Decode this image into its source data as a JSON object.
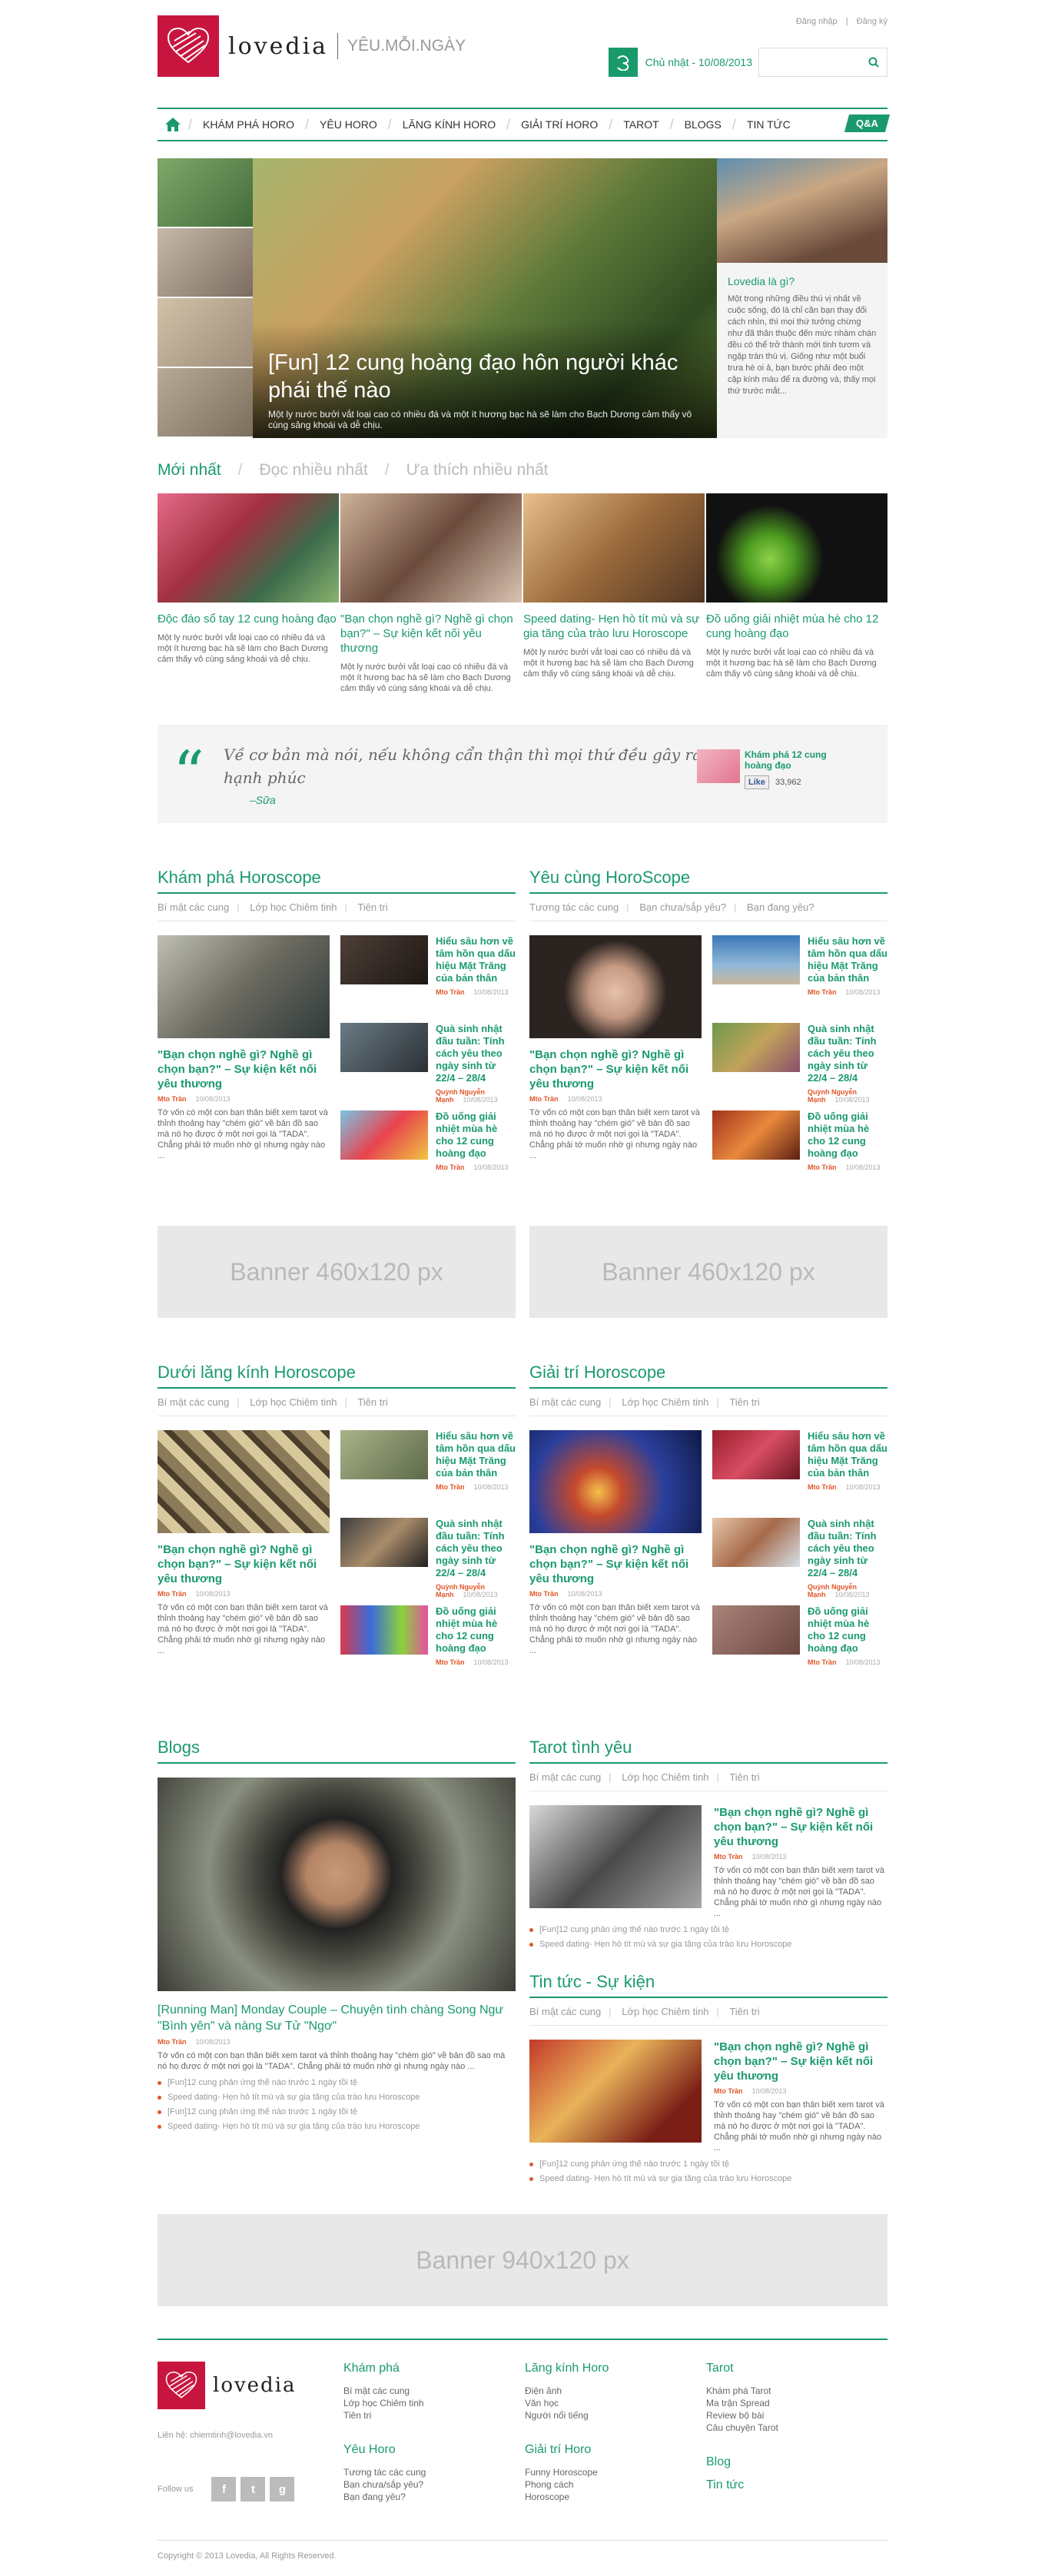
{
  "header": {
    "logo_text": "lovedia",
    "tagline": "YÊU.MỖI.NGÀY",
    "login": "Đăng nhập",
    "sep": "|",
    "register": "Đăng ký",
    "date": "Chủ nhật - 10/08/2013",
    "search_placeholder": ""
  },
  "nav": {
    "items": [
      "KHÁM PHÁ HORO",
      "YÊU HORO",
      "LĂNG KÍNH HORO",
      "GIẢI TRÍ HORO",
      "TAROT",
      "BLOGS",
      "TIN TỨC"
    ],
    "qa": "Q&A"
  },
  "hero": {
    "title": "[Fun] 12 cung hoàng đạo hôn người khác phái thế nào",
    "excerpt": "Một ly nước bưởi vắt loại cao có nhiều đá và một ít hương bạc hà sẽ làm cho Bạch Dương cảm thấy vô cùng sảng khoái và dễ chịu.",
    "side_title": "Lovedia là gì?",
    "side_text": "Một trong những điều thú vị nhất về cuộc sống, đó là chỉ cần bạn thay đổi cách nhìn, thì mọi thứ tưởng chừng như đã thân thuộc đến mức nhàm chán đều có thể trở thành mới tinh tươm và ngập tràn thú vị. Giống như một buổi trưa hè oi ả, bạn bước phải đeo một cặp kính màu để ra đường và, thấy mọi thứ trước mắt..."
  },
  "latest_tabs": [
    "Mới nhất",
    "Đọc nhiều nhất",
    "Ưa thích nhiều nhất"
  ],
  "latest": [
    {
      "title": "Độc đáo sổ tay 12 cung hoàng đạo",
      "excerpt": "Một ly nước bưởi vắt loại cao có nhiều đá và một ít hương bạc hà sẽ làm cho Bạch Dương cảm thấy vô cùng sảng khoái và dễ chịu."
    },
    {
      "title": "\"Bạn chọn nghề gì? Nghề gì chọn bạn?\" – Sự kiện kết nối yêu thương",
      "excerpt": "Một ly nước bưởi vắt loại cao có nhiều đá và một ít hương bạc hà sẽ làm cho Bạch Dương cảm thấy vô cùng sảng khoái và dễ chịu."
    },
    {
      "title": "Speed dating- Hẹn hò tít mù và sự gia tăng của trào lưu Horoscope",
      "excerpt": "Một ly nước bưởi vắt loại cao có nhiều đá và một ít hương bạc hà sẽ làm cho Bạch Dương cảm thấy vô cùng sảng khoái và dễ chịu."
    },
    {
      "title": "Đồ uống giải nhiệt mùa hè cho 12 cung hoàng đạo",
      "excerpt": "Một ly nước bưởi vắt loại cao có nhiều đá và một ít hương bạc hà sẽ làm cho Bạch Dương cảm thấy vô cùng sảng khoái và dễ chịu."
    }
  ],
  "quote": {
    "text": "Về cơ bản mà nói, nếu không cẩn thận thì mọi thứ đều gây ra hạnh phúc",
    "author": "–Sữa",
    "fb_title": "Khám phá 12 cung hoàng đạo",
    "like": "Like",
    "likes": "33,962"
  },
  "sections": [
    {
      "title": "Khám phá Horoscope",
      "subs": [
        "Bí mật các cung",
        "Lớp học Chiêm tinh",
        "Tiên tri"
      ],
      "main": {
        "title": "\"Bạn chọn nghề gì? Nghề gì chọn bạn?\" – Sự kiện kết nối yêu thương",
        "author": "Mto Trần",
        "date": "10/08/2013",
        "excerpt": "Tớ vốn có một con bạn thân biết xem tarot và thỉnh thoảng hay \"chém gió\" về bản đồ sao mà nó họ được ở một nơi gọi là \"TADA\". Chẳng phải tớ muốn nhờ gì nhưng ngày nào ..."
      },
      "minis": [
        {
          "title": "Hiểu sâu hơn về tâm hồn qua dấu hiệu Mặt Trăng của bản thân",
          "author": "Mto Trần",
          "date": "10/08/2013"
        },
        {
          "title": "Quà sinh nhật đầu tuần: Tính cách yêu theo ngày sinh từ 22/4 – 28/4",
          "author": "Quỳnh Nguyễn Mạnh",
          "date": "10/08/2013"
        },
        {
          "title": "Đồ uống giải nhiệt mùa hè cho 12 cung hoàng đạo",
          "author": "Mto Trần",
          "date": "10/08/2013"
        }
      ]
    },
    {
      "title": "Yêu cùng HoroScope",
      "subs": [
        "Tương tác các cung",
        "Bạn chưa/sắp yêu?",
        "Bạn đang yêu?"
      ],
      "main": {
        "title": "\"Bạn chọn nghề gì? Nghề gì chọn bạn?\" – Sự kiện kết nối yêu thương",
        "author": "Mto Trần",
        "date": "10/08/2013",
        "excerpt": "Tớ vốn có một con bạn thân biết xem tarot và thỉnh thoảng hay \"chém gió\" về bản đồ sao mà nó họ được ở một nơi gọi là \"TADA\". Chẳng phải tớ muốn nhờ gì nhưng ngày nào ..."
      },
      "minis": [
        {
          "title": "Hiểu sâu hơn về tâm hồn qua dấu hiệu Mặt Trăng của bản thân",
          "author": "Mto Trần",
          "date": "10/08/2013"
        },
        {
          "title": "Quà sinh nhật đầu tuần: Tính cách yêu theo ngày sinh từ 22/4 – 28/4",
          "author": "Quỳnh Nguyễn Mạnh",
          "date": "10/08/2013"
        },
        {
          "title": "Đồ uống giải nhiệt mùa hè cho 12 cung hoàng đạo",
          "author": "Mto Trần",
          "date": "10/08/2013"
        }
      ]
    },
    {
      "title": "Dưới lăng kính Horoscope",
      "subs": [
        "Bí mật các cung",
        "Lớp học Chiêm tinh",
        "Tiên tri"
      ],
      "main": {
        "title": "\"Bạn chọn nghề gì? Nghề gì chọn bạn?\" – Sự kiện kết nối yêu thương",
        "author": "Mto Trần",
        "date": "10/08/2013",
        "excerpt": "Tớ vốn có một con bạn thân biết xem tarot và thỉnh thoảng hay \"chém gió\" về bản đồ sao mà nó họ được ở một nơi gọi là \"TADA\". Chẳng phải tớ muốn nhờ gì nhưng ngày nào ..."
      },
      "minis": [
        {
          "title": "Hiểu sâu hơn về tâm hồn qua dấu hiệu Mặt Trăng của bản thân",
          "author": "Mto Trần",
          "date": "10/08/2013"
        },
        {
          "title": "Quà sinh nhật đầu tuần: Tính cách yêu theo ngày sinh từ 22/4 – 28/4",
          "author": "Quỳnh Nguyễn Mạnh",
          "date": "10/08/2013"
        },
        {
          "title": "Đồ uống giải nhiệt mùa hè cho 12 cung hoàng đạo",
          "author": "Mto Trần",
          "date": "10/08/2013"
        }
      ]
    },
    {
      "title": "Giải trí Horoscope",
      "subs": [
        "Bí mật các cung",
        "Lớp học Chiêm tinh",
        "Tiên tri"
      ],
      "main": {
        "title": "\"Bạn chọn nghề gì? Nghề gì chọn bạn?\" – Sự kiện kết nối yêu thương",
        "author": "Mto Trần",
        "date": "10/08/2013",
        "excerpt": "Tớ vốn có một con bạn thân biết xem tarot và thỉnh thoảng hay \"chém gió\" về bản đồ sao mà nó họ được ở một nơi gọi là \"TADA\". Chẳng phải tớ muốn nhờ gì nhưng ngày nào ..."
      },
      "minis": [
        {
          "title": "Hiểu sâu hơn về tâm hồn qua dấu hiệu Mặt Trăng của bản thân",
          "author": "Mto Trần",
          "date": "10/08/2013"
        },
        {
          "title": "Quà sinh nhật đầu tuần: Tính cách yêu theo ngày sinh từ 22/4 – 28/4",
          "author": "Quỳnh Nguyễn Mạnh",
          "date": "10/08/2013"
        },
        {
          "title": "Đồ uống giải nhiệt mùa hè cho 12 cung hoàng đạo",
          "author": "Mto Trần",
          "date": "10/08/2013"
        }
      ]
    }
  ],
  "banner_small": "Banner 460x120 px",
  "banner_big": "Banner 940x120 px",
  "blogs": {
    "title": "Blogs",
    "post_title": "[Running Man] Monday Couple – Chuyện tình chàng Song Ngư \"Bình yên\" và nàng Sư Tử \"Ngơ\"",
    "author": "Mto Trần",
    "date": "10/08/2013",
    "excerpt": "Tớ vốn có một con bạn thân biết xem tarot và thỉnh thoảng hay \"chém gió\" về bản đồ sao mà nó họ được ở một nơi gọi là \"TADA\". Chẳng phải tớ muốn nhờ gì nhưng ngày nào ...",
    "bullets": [
      "[Fun]12 cung phản ứng thế nào trước 1 ngày tồi tệ",
      "Speed dating- Hẹn hò tít mù và sự gia tăng của trào lưu Horoscope",
      "[Fun]12 cung phản ứng thế nào trước 1 ngày tồi tệ",
      "Speed dating- Hẹn hò tít mù và sự gia tăng của trào lưu Horoscope"
    ]
  },
  "tarot": {
    "title": "Tarot tình yêu",
    "subs": [
      "Bí mật các cung",
      "Lớp học Chiêm tinh",
      "Tiên tri"
    ],
    "post_title": "\"Bạn chọn nghề gì? Nghề gì chọn bạn?\" – Sự kiện kết nối yêu thương",
    "author": "Mto Trần",
    "date": "10/08/2013",
    "excerpt": "Tớ vốn có một con bạn thân biết xem tarot và thỉnh thoảng hay \"chém gió\" về bản đồ sao mà nó họ được ở một nơi gọi là \"TADA\". Chẳng phải tớ muốn nhờ gì nhưng ngày nào ...",
    "bullets": [
      "[Fun]12 cung phản ứng thế nào trước 1 ngày tồi tệ",
      "Speed dating- Hẹn hò tít mù và sự gia tăng của trào lưu Horoscope"
    ]
  },
  "news": {
    "title": "Tin tức - Sự kiện",
    "subs": [
      "Bí mật các cung",
      "Lớp học Chiêm tinh",
      "Tiên tri"
    ],
    "post_title": "\"Bạn chọn nghề gì? Nghề gì chọn bạn?\" – Sự kiện kết nối yêu thương",
    "author": "Mto Trần",
    "date": "10/08/2013",
    "excerpt": "Tớ vốn có một con bạn thân biết xem tarot và thỉnh thoảng hay \"chém gió\" về bản đồ sao mà nó họ được ở một nơi gọi là \"TADA\". Chẳng phải tớ muốn nhờ gì nhưng ngày nào ...",
    "bullets": [
      "[Fun]12 cung phản ứng thế nào trước 1 ngày tồi tệ",
      "Speed dating- Hẹn hò tít mù và sự gia tăng của trào lưu Horoscope"
    ]
  },
  "footer": {
    "logo_text": "lovedia",
    "contact": "Liên hệ: chiemtinh@lovedia.vn",
    "follow": "Follow us",
    "social": [
      "f",
      "t",
      "g"
    ],
    "col1": {
      "h1": "Khám phá",
      "l1": [
        "Bí mật các cung",
        "Lớp học Chiêm tinh",
        "Tiên tri"
      ],
      "h2": "Yêu Horo",
      "l2": [
        "Tương tác các cung",
        "Bạn chưa/sắp yêu?",
        "Bạn đang yêu?"
      ]
    },
    "col2": {
      "h1": "Lăng kính Horo",
      "l1": [
        "Điện ảnh",
        "Văn học",
        "Người nổi tiếng"
      ],
      "h2": "Giải trí Horo",
      "l2": [
        "Funny Horoscope",
        "Phong cách",
        "Horoscope"
      ]
    },
    "col3": {
      "h1": "Tarot",
      "l1": [
        "Khám phá Tarot",
        "Ma trận Spread",
        "Review bộ bài",
        "Câu chuyện Tarot"
      ],
      "h2": "Blog",
      "h3": "Tin tức"
    },
    "copyright": "Copyright © 2013 Lovedia, All Rights Reserved."
  },
  "colors": {
    "accent": "#1a9a6c",
    "brand": "#c8153f",
    "author": "#e0562b"
  }
}
